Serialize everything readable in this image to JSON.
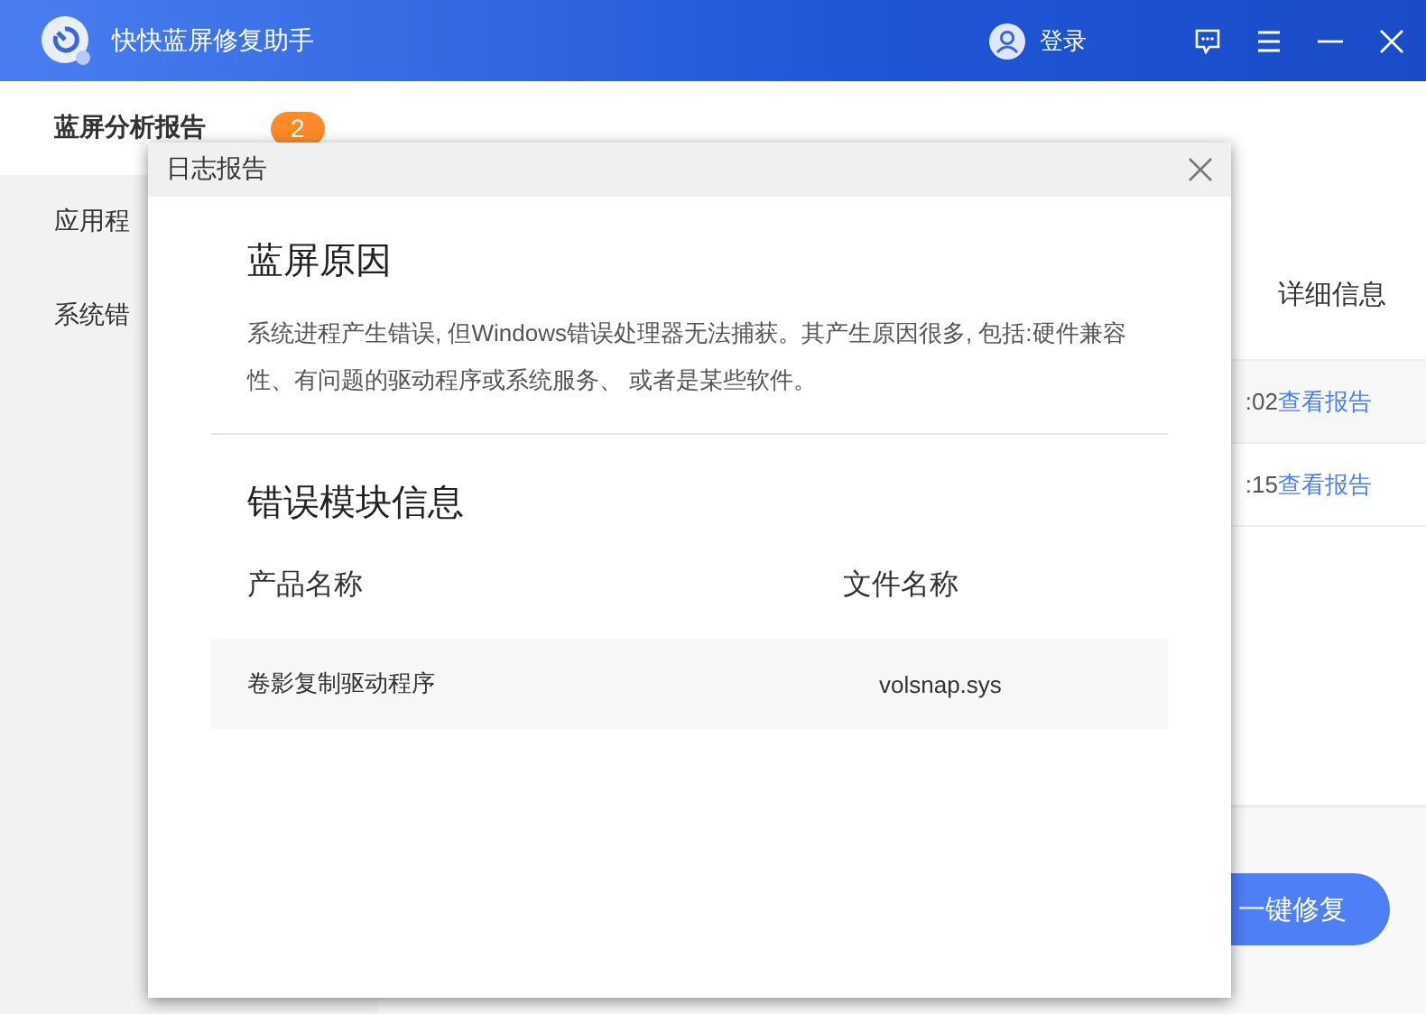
{
  "window": {
    "title": "快快蓝屏修复助手",
    "login": "登录"
  },
  "sidebar": {
    "items": [
      {
        "label": "蓝屏分析报告",
        "selected": true,
        "badge": "2"
      },
      {
        "label": "应用程",
        "selected": false
      },
      {
        "label": "系统错",
        "selected": false
      }
    ]
  },
  "main": {
    "table": {
      "column_header": "详细信息",
      "rows": [
        {
          "time": ":02",
          "link": "查看报告"
        },
        {
          "time": ":15",
          "link": "查看报告"
        }
      ]
    },
    "repair_button": "一键修复"
  },
  "dialog": {
    "title": "日志报告",
    "cause_heading": "蓝屏原因",
    "cause_text": "系统进程产生错误, 但Windows错误处理器无法捕获。其产生原因很多, 包括:硬件兼容性、有问题的驱动程序或系统服务、 或者是某些软件。",
    "module_heading": "错误模块信息",
    "columns": [
      "产品名称",
      "文件名称"
    ],
    "rows": [
      {
        "product": "卷影复制驱动程序",
        "file": "volsnap.sys"
      }
    ]
  }
}
